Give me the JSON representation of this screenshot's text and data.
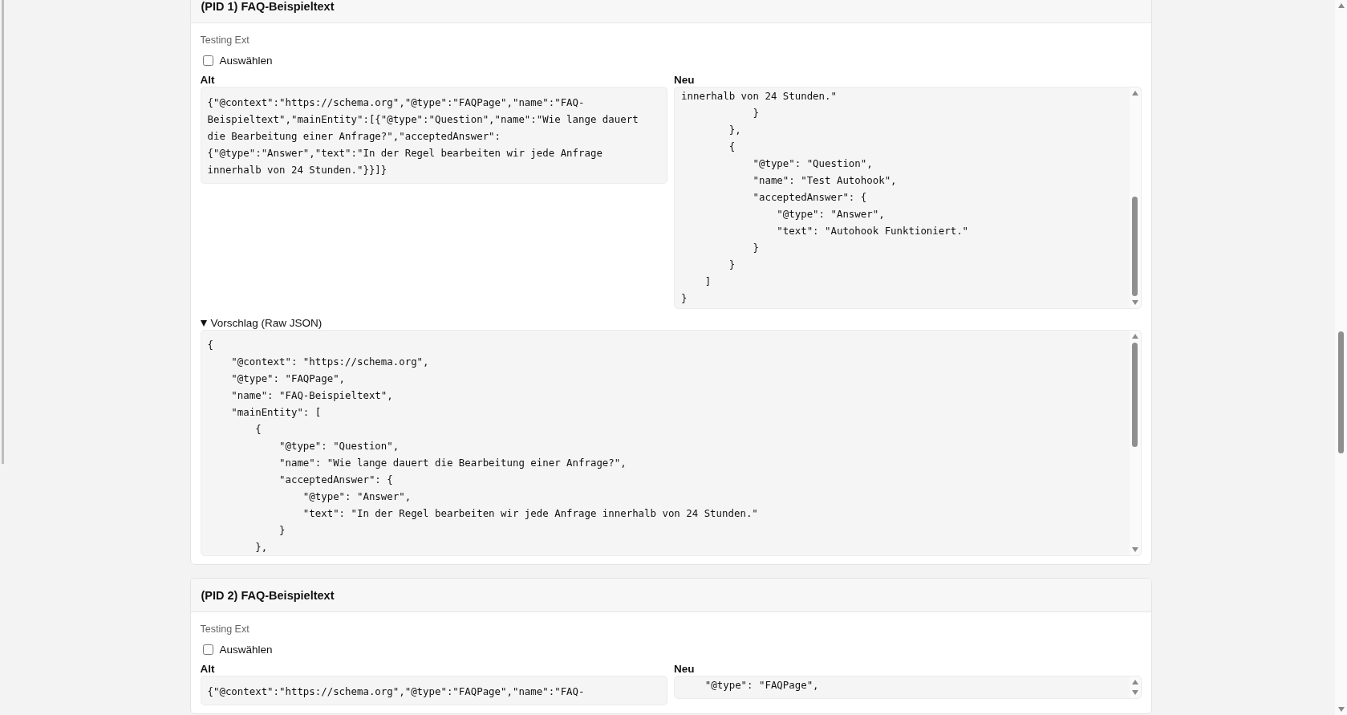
{
  "cards": [
    {
      "title": "(PID 1) FAQ-Beispieltext",
      "source": "Testing Ext",
      "select": {
        "label": "Auswählen",
        "checked": false
      },
      "old": {
        "label": "Alt",
        "code": "{\"@context\":\"https://schema.org\",\"@type\":\"FAQPage\",\"name\":\"FAQ-Beispieltext\",\"mainEntity\":[{\"@type\":\"Question\",\"name\":\"Wie lange dauert die Bearbeitung einer Anfrage?\",\"acceptedAnswer\":{\"@type\":\"Answer\",\"text\":\"In der Regel bearbeiten wir jede Anfrage innerhalb von 24 Stunden.\"}}]}"
      },
      "new": {
        "label": "Neu",
        "code": "innerhalb von 24 Stunden.\"\n            }\n        },\n        {\n            \"@type\": \"Question\",\n            \"name\": \"Test Autohook\",\n            \"acceptedAnswer\": {\n                \"@type\": \"Answer\",\n                \"text\": \"Autohook Funktioniert.\"\n            }\n        }\n    ]\n}"
      },
      "suggestion": {
        "label": "Vorschlag (Raw JSON)",
        "expanded": true,
        "code": "{\n    \"@context\": \"https://schema.org\",\n    \"@type\": \"FAQPage\",\n    \"name\": \"FAQ-Beispieltext\",\n    \"mainEntity\": [\n        {\n            \"@type\": \"Question\",\n            \"name\": \"Wie lange dauert die Bearbeitung einer Anfrage?\",\n            \"acceptedAnswer\": {\n                \"@type\": \"Answer\",\n                \"text\": \"In der Regel bearbeiten wir jede Anfrage innerhalb von 24 Stunden.\"\n            }\n        },"
      }
    },
    {
      "title": "(PID 2) FAQ-Beispieltext",
      "source": "Testing Ext",
      "select": {
        "label": "Auswählen",
        "checked": false
      },
      "old": {
        "label": "Alt",
        "code": "{\"@context\":\"https://schema.org\",\"@type\":\"FAQPage\",\"name\":\"FAQ-"
      },
      "new": {
        "label": "Neu",
        "code": "    \"@type\": \"FAQPage\","
      }
    }
  ]
}
